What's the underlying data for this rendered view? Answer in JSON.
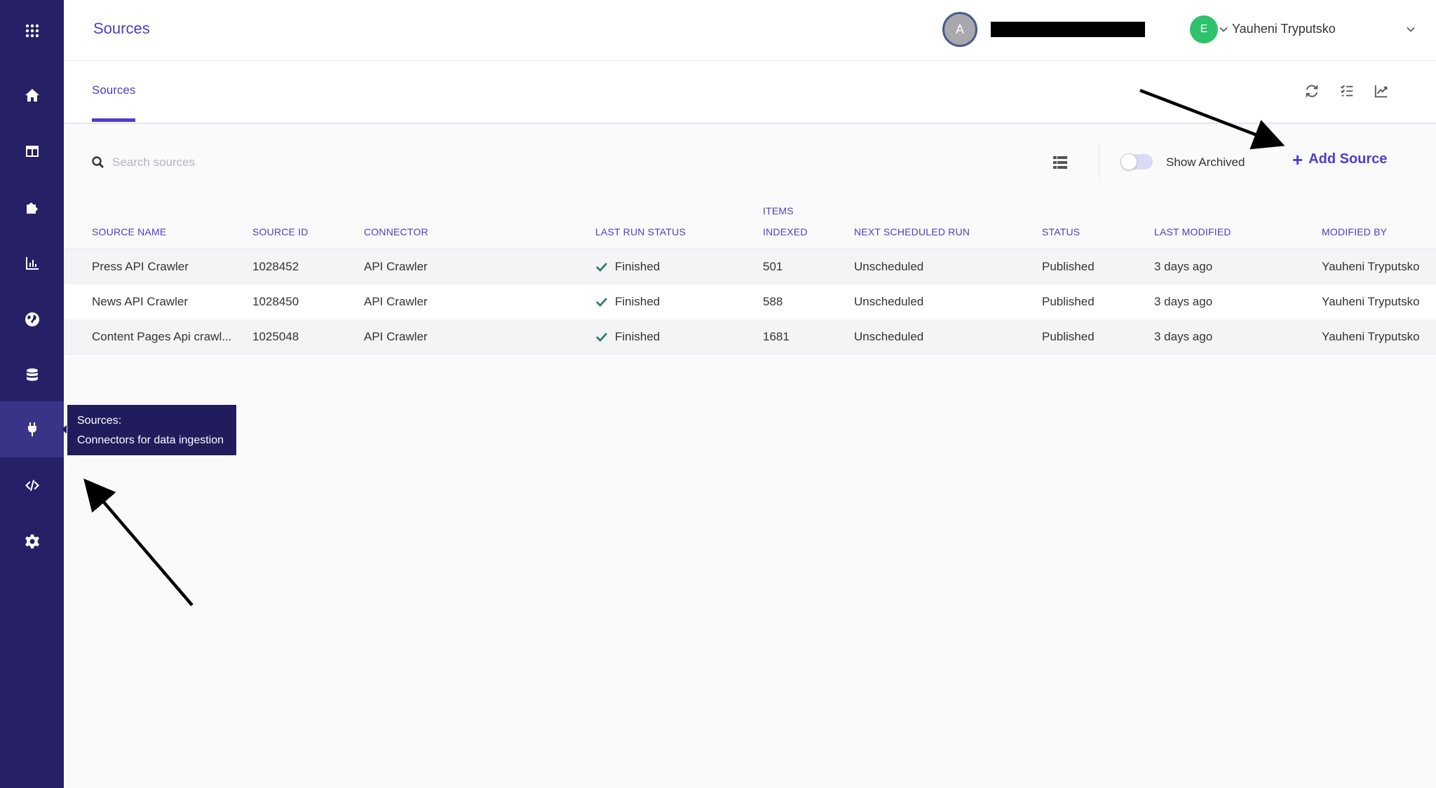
{
  "header": {
    "title": "Sources",
    "org_avatar_initial": "A",
    "user_avatar_initial": "E",
    "user_name": "Yauheni Tryputsko"
  },
  "sidebar": {
    "items": [
      {
        "icon": "grid-apps-icon"
      },
      {
        "icon": "home-icon"
      },
      {
        "icon": "layout-icon"
      },
      {
        "icon": "puzzle-icon"
      },
      {
        "icon": "bar-chart-icon"
      },
      {
        "icon": "globe-icon"
      },
      {
        "icon": "database-icon"
      },
      {
        "icon": "plug-icon",
        "active": true
      },
      {
        "icon": "code-icon"
      },
      {
        "icon": "gear-icon"
      }
    ]
  },
  "tabs": [
    {
      "label": "Sources",
      "active": true
    }
  ],
  "toolbar": {
    "search_placeholder": "Search sources",
    "show_archived_label": "Show Archived",
    "show_archived": false,
    "add_source_label": "Add Source"
  },
  "table": {
    "columns": {
      "source_name": "SOURCE NAME",
      "source_id": "SOURCE ID",
      "connector": "CONNECTOR",
      "last_run_status": "LAST RUN STATUS",
      "items_indexed_1": "ITEMS",
      "items_indexed_2": "INDEXED",
      "next_scheduled_run": "NEXT SCHEDULED RUN",
      "status": "STATUS",
      "last_modified": "LAST MODIFIED",
      "modified_by": "MODIFIED BY"
    },
    "rows": [
      {
        "name": "Press API Crawler",
        "id": "1028452",
        "connector": "API Crawler",
        "last_run": "Finished",
        "items": "501",
        "next_run": "Unscheduled",
        "status": "Published",
        "modified": "3 days ago",
        "by": "Yauheni Tryputsko"
      },
      {
        "name": "News API Crawler",
        "id": "1028450",
        "connector": "API Crawler",
        "last_run": "Finished",
        "items": "588",
        "next_run": "Unscheduled",
        "status": "Published",
        "modified": "3 days ago",
        "by": "Yauheni Tryputsko"
      },
      {
        "name": "Content Pages Api crawl...",
        "id": "1025048",
        "connector": "API Crawler",
        "last_run": "Finished",
        "items": "1681",
        "next_run": "Unscheduled",
        "status": "Published",
        "modified": "3 days ago",
        "by": "Yauheni Tryputsko"
      }
    ]
  },
  "tooltip": {
    "title": "Sources:",
    "description": "Connectors for data ingestion"
  },
  "colors": {
    "sidebar_bg": "#262066",
    "accent": "#4b3fc8",
    "success": "#2a7d6e",
    "user_avatar": "#2dc26b"
  }
}
